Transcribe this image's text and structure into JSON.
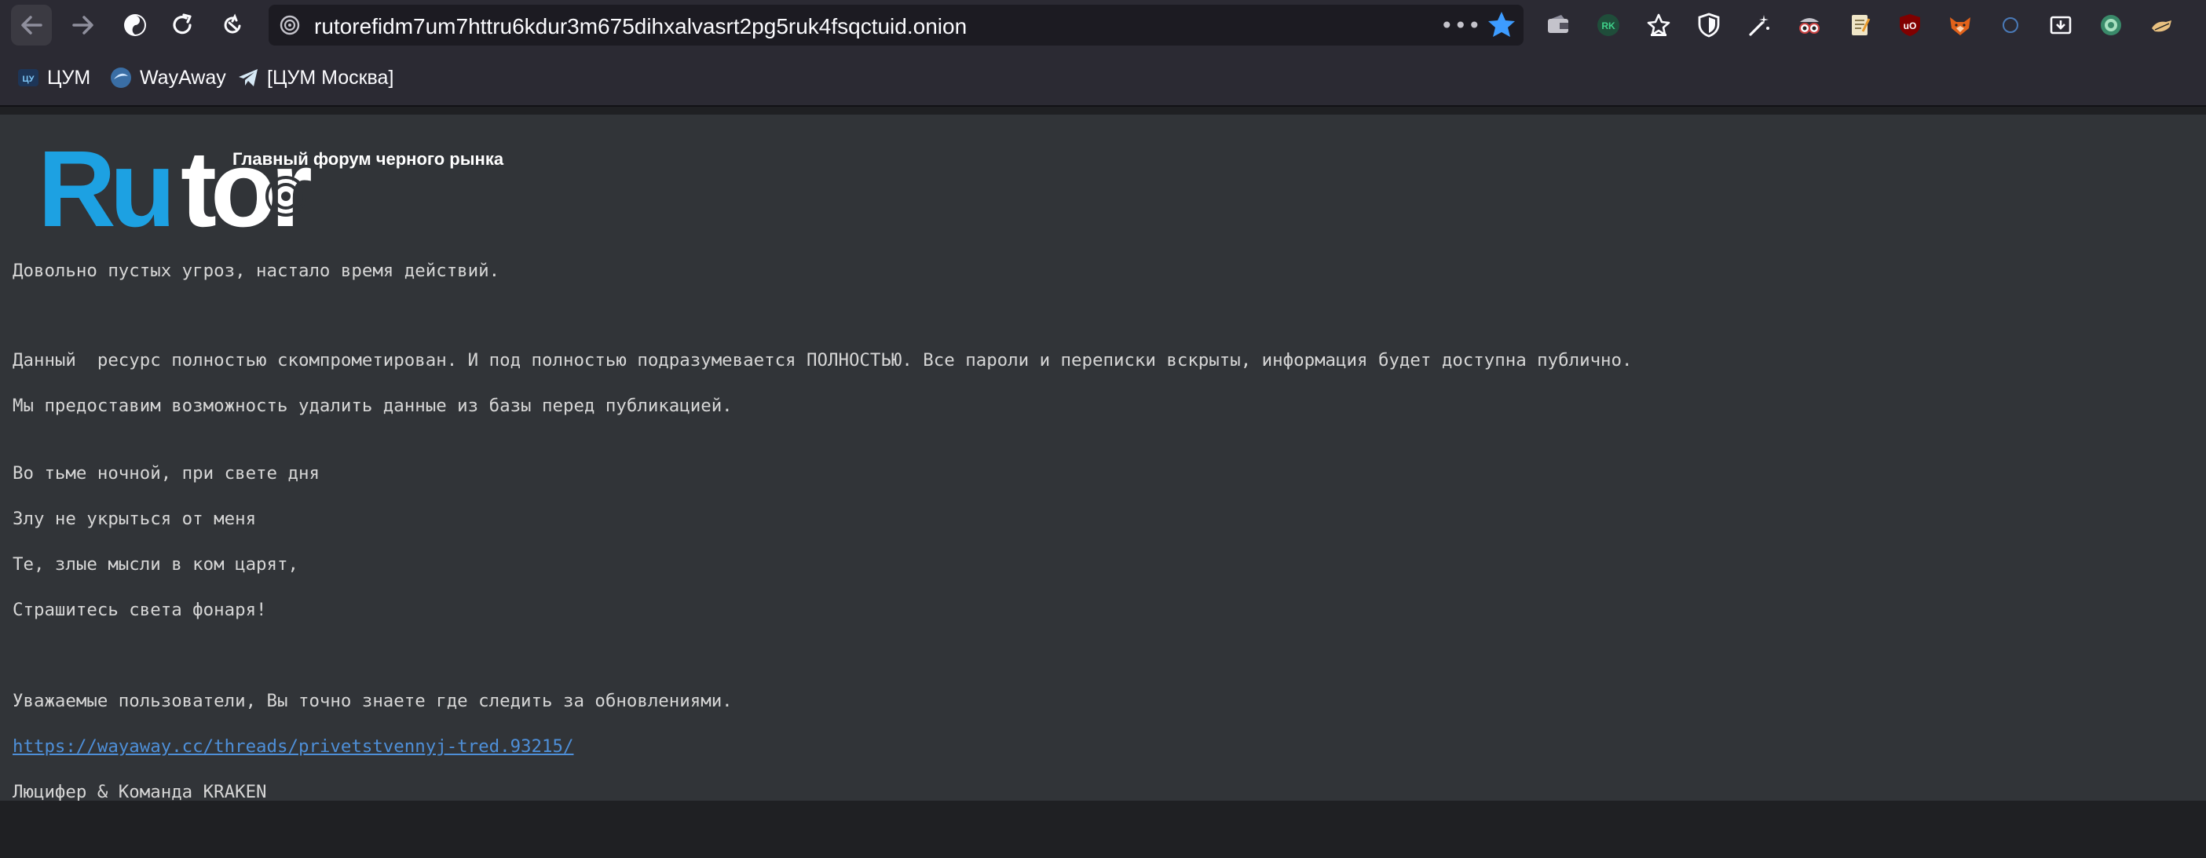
{
  "browser": {
    "url": "rutorefidm7um7httru6kdur3m675dihxalvasrt2pg5ruk4fsqctuid.onion",
    "more_label": "•••",
    "accent": "#3d9cff",
    "extensions": [
      "wallet-icon",
      "rk-icon",
      "bookmark-star-icon",
      "shield-icon",
      "magic-wand-icon",
      "spy-glasses-icon",
      "note-icon",
      "ublock-icon",
      "fox-icon",
      "circle-icon",
      "download-box-icon",
      "globe-icon",
      "hand-icon"
    ]
  },
  "bookmarks": [
    {
      "label": "ЦУМ"
    },
    {
      "label": "WayAway"
    },
    {
      "label": "[ЦУМ Москва]"
    }
  ],
  "page": {
    "logo": {
      "brand_left": "Ru",
      "brand_right": "tor",
      "tagline": "Главный форум черного рынка",
      "brand_color": "#1da1e2"
    },
    "lines": [
      "Довольно пустых угроз, настало время действий.",
      "Данный  ресурс полностью скомпрометирован. И под полностью подразумевается ПОЛНОСТЬЮ. Все пароли и переписки вскрыты, информация будет доступна публично.",
      "Мы предоставим возможность удалить данные из базы перед публикацией.",
      "Во тьме ночной, при свете дня",
      "Злу не укрыться от меня",
      "Те, злые мысли в ком царят,",
      "Страшитесь света фонаря!",
      "Уважаемые пользователи, Вы точно знаете где следить за обновлениями.",
      "https://wayaway.cc/threads/privetstvennyj-tred.93215/",
      "Люцифер & Команда KRAKEN"
    ]
  }
}
